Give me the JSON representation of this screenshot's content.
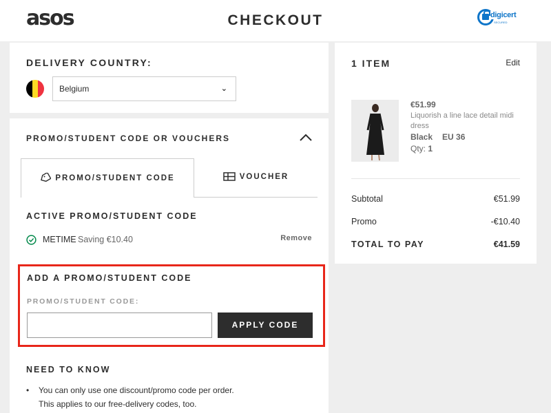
{
  "header": {
    "logo": "asos",
    "title": "CHECKOUT",
    "badge_brand": "digicert",
    "badge_sub": "SECURED"
  },
  "delivery": {
    "title": "DELIVERY COUNTRY:",
    "country": "Belgium",
    "flag_colors": [
      "#000000",
      "#fdda24",
      "#ef3340"
    ]
  },
  "promo": {
    "heading": "PROMO/STUDENT CODE OR VOUCHERS",
    "tabs": [
      {
        "label": "PROMO/STUDENT CODE",
        "icon": "tag-icon",
        "active": true
      },
      {
        "label": "VOUCHER",
        "icon": "voucher-icon",
        "active": false
      }
    ],
    "active_title": "ACTIVE PROMO/STUDENT CODE",
    "active_code": "METIME",
    "active_saving": "Saving €10.40",
    "remove_label": "Remove",
    "add_title": "ADD A PROMO/STUDENT CODE",
    "code_label": "PROMO/STUDENT CODE:",
    "code_value": "",
    "apply_label": "APPLY CODE",
    "need_title": "NEED TO KNOW",
    "need_line1": "You can only use one discount/promo code per order.",
    "need_line2": "This applies to our free-delivery codes, too."
  },
  "summary": {
    "items_count": "1 ITEM",
    "edit_label": "Edit",
    "product": {
      "price": "€51.99",
      "name": "Liquorish a line lace detail midi dress",
      "colour": "Black",
      "size": "EU 36",
      "qty_label": "Qty:",
      "qty": "1"
    },
    "subtotal_label": "Subtotal",
    "subtotal_value": "€51.99",
    "promo_label": "Promo",
    "promo_value": "-€10.40",
    "total_label": "TOTAL TO PAY",
    "total_value": "€41.59"
  },
  "colors": {
    "accent_highlight": "#e8261a",
    "button_dark": "#2d2d2d",
    "check_green": "#018849",
    "digicert_blue": "#0e75c9"
  }
}
